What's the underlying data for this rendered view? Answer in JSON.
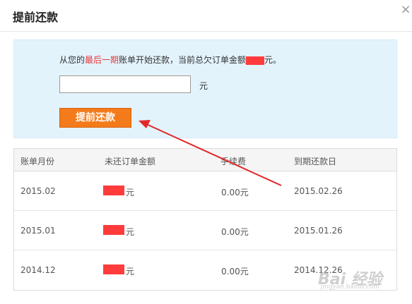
{
  "dialog": {
    "title": "提前还款",
    "close_symbol": "×"
  },
  "info": {
    "prefix": "从您的",
    "highlight": "最后一期",
    "middle": "账单开始还款，当前总欠订单金额",
    "suffix": "元。",
    "highlight_color": "#e4393c"
  },
  "input": {
    "value": "",
    "unit": "元"
  },
  "button": {
    "label": "提前还款",
    "color": "#f47b1b"
  },
  "table": {
    "headers": [
      "账单月份",
      "未还订单金额",
      "手续费",
      "到期还款日"
    ],
    "rows": [
      {
        "month": "2015.02",
        "amount_unit": "元",
        "fee": "0.00元",
        "due": "2015.02.26"
      },
      {
        "month": "2015.01",
        "amount_unit": "元",
        "fee": "0.00元",
        "due": "2015.01.26"
      },
      {
        "month": "2014.12",
        "amount_unit": "元",
        "fee": "0.00元",
        "due": "2014.12.26"
      }
    ]
  },
  "watermark": {
    "brand": "Bai 经验",
    "url": "jingyan.baidu.com"
  },
  "colors": {
    "panel_bg": "#e3f3fc",
    "redaction": "#ff3b3b",
    "arrow": "#e0282a"
  }
}
